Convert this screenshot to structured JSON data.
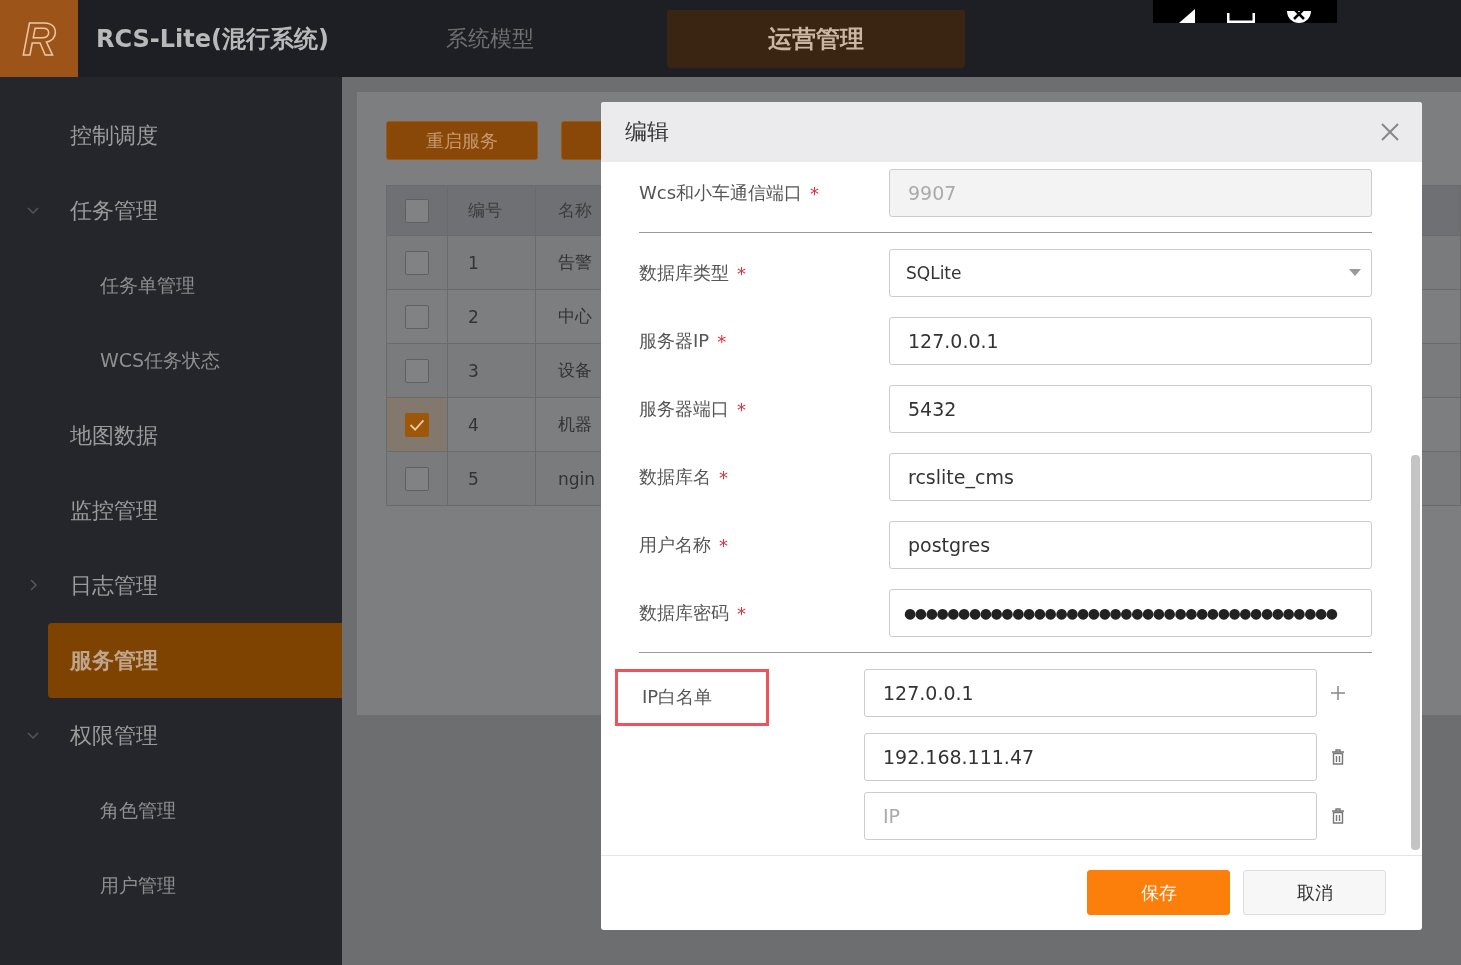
{
  "header": {
    "logo_text": "R",
    "app_title": "RCS-Lite(混行系统)",
    "tabs": [
      {
        "label": "系统模型",
        "selected": false
      },
      {
        "label": "运营管理",
        "selected": true
      }
    ]
  },
  "sidebar": {
    "items": [
      {
        "label": "控制调度",
        "kind": "item",
        "selected": false
      },
      {
        "label": "任务管理",
        "kind": "group",
        "expanded": true,
        "selected": false,
        "children": [
          {
            "label": "任务单管理",
            "selected": false
          },
          {
            "label": "WCS任务状态",
            "selected": false
          }
        ]
      },
      {
        "label": "地图数据",
        "kind": "item",
        "selected": false
      },
      {
        "label": "监控管理",
        "kind": "item",
        "selected": false
      },
      {
        "label": "日志管理",
        "kind": "group",
        "expanded": false,
        "selected": false
      },
      {
        "label": "服务管理",
        "kind": "item",
        "selected": true
      },
      {
        "label": "权限管理",
        "kind": "group",
        "expanded": true,
        "selected": false,
        "children": [
          {
            "label": "角色管理",
            "selected": false
          },
          {
            "label": "用户管理",
            "selected": false
          }
        ]
      }
    ]
  },
  "toolbar": {
    "buttons": [
      {
        "kind": "labeled",
        "label": "重启服务"
      },
      {
        "kind": "covered"
      }
    ]
  },
  "table": {
    "header_checked": false,
    "columns": [
      {
        "label": "编号"
      },
      {
        "label": "名称"
      }
    ],
    "rows": [
      {
        "checked": false,
        "cells": [
          "1",
          "告警"
        ]
      },
      {
        "checked": false,
        "cells": [
          "2",
          "中心"
        ]
      },
      {
        "checked": false,
        "cells": [
          "3",
          "设备"
        ]
      },
      {
        "checked": true,
        "cells": [
          "4",
          "机器"
        ]
      },
      {
        "checked": false,
        "cells": [
          "5",
          "ngin"
        ]
      }
    ]
  },
  "dialog": {
    "title": "编辑",
    "fields": [
      {
        "label": "Wcs和小车通信端口",
        "required_mark": "*",
        "kind": "input",
        "value": "9907",
        "disabled": true,
        "divider_after": true
      },
      {
        "label": "数据库类型",
        "required_mark": "*",
        "kind": "select",
        "value": "SQLite",
        "disabled": false,
        "divider_after": false
      },
      {
        "label": "服务器IP",
        "required_mark": "*",
        "kind": "input",
        "value": "127.0.0.1",
        "disabled": false,
        "divider_after": false
      },
      {
        "label": "服务器端口",
        "required_mark": "*",
        "kind": "input",
        "value": "5432",
        "disabled": false,
        "divider_after": false
      },
      {
        "label": "数据库名",
        "required_mark": "*",
        "kind": "input",
        "value": "rcslite_cms",
        "disabled": false,
        "divider_after": false
      },
      {
        "label": "用户名称",
        "required_mark": "*",
        "kind": "input",
        "value": "postgres",
        "disabled": false,
        "divider_after": false
      },
      {
        "label": "数据库密码",
        "required_mark": "*",
        "kind": "password",
        "value": "●●●●●●●●●●●●●●●●●●●●●●●●●●●●●●●●●●●●●●●●",
        "disabled": false,
        "divider_after": true
      }
    ],
    "whitelist": {
      "label": "IP白名单",
      "highlighted": true,
      "entries": [
        {
          "value": "127.0.0.1",
          "kind": "add"
        },
        {
          "value": "192.168.111.47",
          "kind": "delete"
        },
        {
          "placeholder": "IP",
          "kind": "delete"
        }
      ]
    },
    "buttons": [
      {
        "label": "保存",
        "kind": "primary"
      },
      {
        "label": "取消",
        "kind": "default"
      }
    ]
  }
}
